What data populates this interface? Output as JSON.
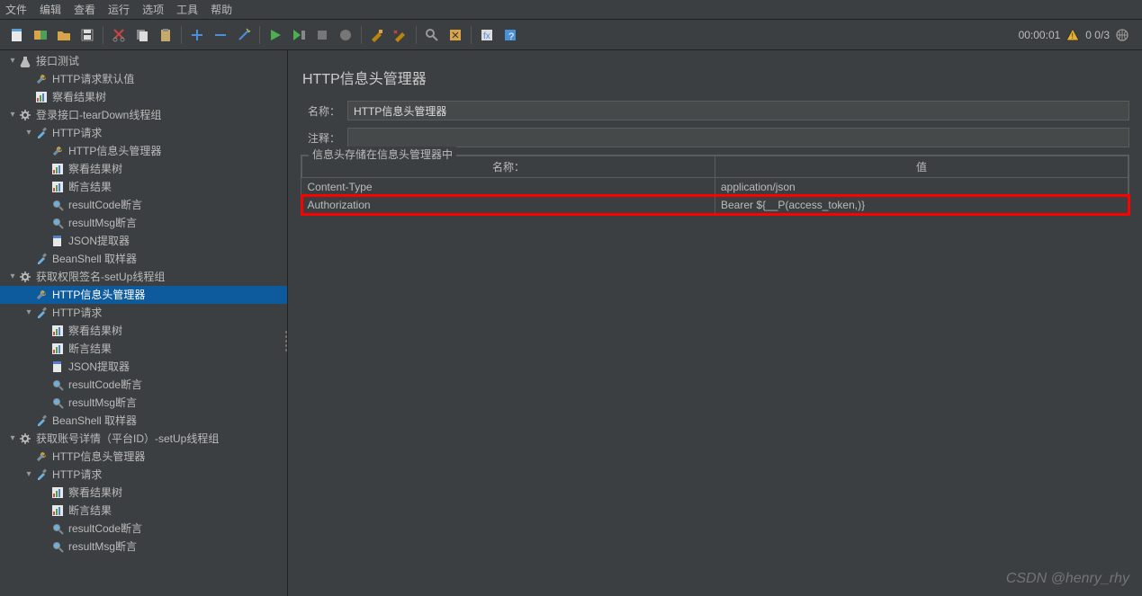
{
  "menu": [
    "文件",
    "编辑",
    "查看",
    "运行",
    "选项",
    "工具",
    "帮助"
  ],
  "toolbar_right": {
    "time": "00:00:01",
    "counts": "0   0/3"
  },
  "tree": [
    {
      "indent": 0,
      "tw": "▾",
      "icon": "flask",
      "label": "接口测试"
    },
    {
      "indent": 1,
      "tw": "",
      "icon": "wrench",
      "label": "HTTP请求默认值"
    },
    {
      "indent": 1,
      "tw": "",
      "icon": "chart",
      "label": "察看结果树"
    },
    {
      "indent": 0,
      "tw": "▾",
      "icon": "gear",
      "label": "登录接口-tearDown线程组"
    },
    {
      "indent": 1,
      "tw": "▾",
      "icon": "pipette",
      "label": "HTTP请求"
    },
    {
      "indent": 2,
      "tw": "",
      "icon": "wrench",
      "label": "HTTP信息头管理器"
    },
    {
      "indent": 2,
      "tw": "",
      "icon": "chart",
      "label": "察看结果树"
    },
    {
      "indent": 2,
      "tw": "",
      "icon": "chart",
      "label": "断言结果"
    },
    {
      "indent": 2,
      "tw": "",
      "icon": "magnifier",
      "label": "resultCode断言"
    },
    {
      "indent": 2,
      "tw": "",
      "icon": "magnifier",
      "label": "resultMsg断言"
    },
    {
      "indent": 2,
      "tw": "",
      "icon": "doc",
      "label": "JSON提取器"
    },
    {
      "indent": 1,
      "tw": "",
      "icon": "pipette",
      "label": "BeanShell 取样器"
    },
    {
      "indent": 0,
      "tw": "▾",
      "icon": "gear",
      "label": "获取权限签名-setUp线程组"
    },
    {
      "indent": 1,
      "tw": "",
      "icon": "wrench",
      "label": "HTTP信息头管理器",
      "selected": true
    },
    {
      "indent": 1,
      "tw": "▾",
      "icon": "pipette",
      "label": "HTTP请求"
    },
    {
      "indent": 2,
      "tw": "",
      "icon": "chart",
      "label": "察看结果树"
    },
    {
      "indent": 2,
      "tw": "",
      "icon": "chart",
      "label": "断言结果"
    },
    {
      "indent": 2,
      "tw": "",
      "icon": "doc",
      "label": "JSON提取器"
    },
    {
      "indent": 2,
      "tw": "",
      "icon": "magnifier",
      "label": "resultCode断言"
    },
    {
      "indent": 2,
      "tw": "",
      "icon": "magnifier",
      "label": "resultMsg断言"
    },
    {
      "indent": 1,
      "tw": "",
      "icon": "pipette",
      "label": "BeanShell 取样器"
    },
    {
      "indent": 0,
      "tw": "▾",
      "icon": "gear",
      "label": "获取账号详情（平台ID）-setUp线程组"
    },
    {
      "indent": 1,
      "tw": "",
      "icon": "wrench",
      "label": "HTTP信息头管理器"
    },
    {
      "indent": 1,
      "tw": "▾",
      "icon": "pipette",
      "label": "HTTP请求"
    },
    {
      "indent": 2,
      "tw": "",
      "icon": "chart",
      "label": "察看结果树"
    },
    {
      "indent": 2,
      "tw": "",
      "icon": "chart",
      "label": "断言结果"
    },
    {
      "indent": 2,
      "tw": "",
      "icon": "magnifier",
      "label": "resultCode断言"
    },
    {
      "indent": 2,
      "tw": "",
      "icon": "magnifier",
      "label": "resultMsg断言"
    }
  ],
  "panel": {
    "title": "HTTP信息头管理器",
    "name_label": "名称：",
    "name_value": "HTTP信息头管理器",
    "comment_label": "注释：",
    "comment_value": "",
    "fieldset_legend": "信息头存储在信息头管理器中",
    "col_name": "名称：",
    "col_value": "值",
    "rows": [
      {
        "name": "Content-Type",
        "value": "application/json",
        "hl": false
      },
      {
        "name": "Authorization",
        "value": "Bearer ${__P(access_token,)}",
        "hl": true
      }
    ]
  },
  "watermark": "CSDN @henry_rhy"
}
